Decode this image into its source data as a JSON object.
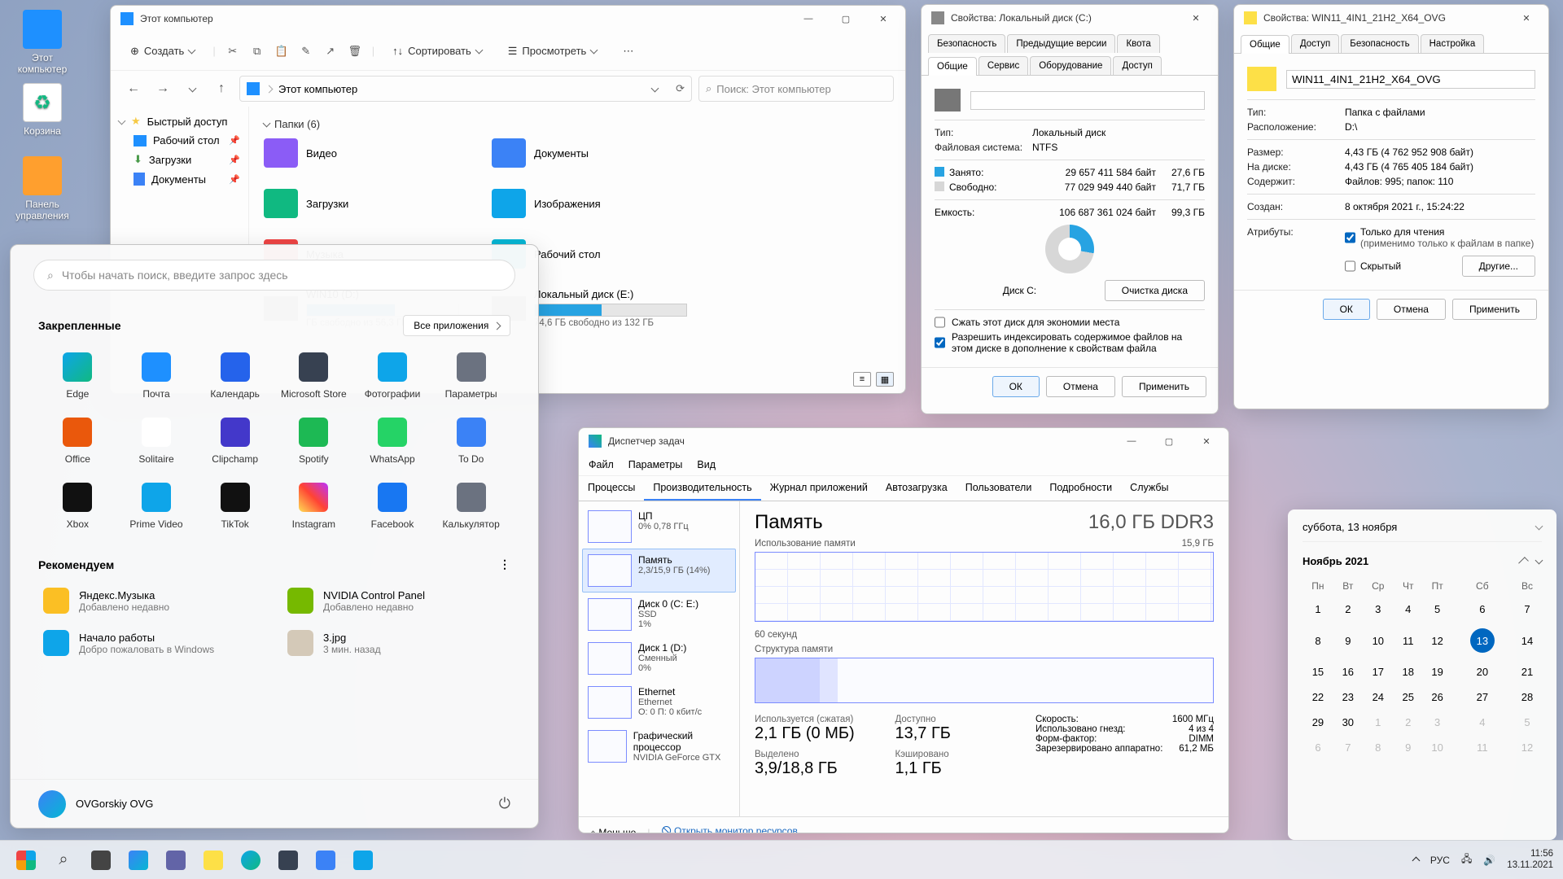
{
  "desktop": {
    "icons": [
      {
        "label": "Этот компьютер",
        "color": "#1e90ff"
      },
      {
        "label": "Корзина",
        "color": "#3bc4d6"
      },
      {
        "label": "Панель управления",
        "color": "#ff9f2e"
      }
    ]
  },
  "explorer": {
    "title": "Этот компьютер",
    "toolbar": {
      "create": "Создать",
      "sort": "Сортировать",
      "view": "Просмотреть"
    },
    "address": "Этот компьютер",
    "search_placeholder": "Поиск: Этот компьютер",
    "sidebar": [
      {
        "label": "Быстрый доступ",
        "icon": "#f6c945",
        "exp": true
      },
      {
        "label": "Рабочий стол",
        "icon": "#1e90ff",
        "pin": true,
        "sub": true
      },
      {
        "label": "Загрузки",
        "icon": "#4b9b4b",
        "pin": true,
        "sub": true
      },
      {
        "label": "Документы",
        "icon": "#3b82f6",
        "pin": true,
        "sub": true
      }
    ],
    "folders_header": "Папки (6)",
    "folders": [
      {
        "label": "Видео",
        "bg": "#8b5cf6"
      },
      {
        "label": "Документы",
        "bg": "#3b82f6"
      },
      {
        "label": "Загрузки",
        "bg": "#10b981"
      },
      {
        "label": "Изображения",
        "bg": "#0ea5e9"
      },
      {
        "label": "Музыка",
        "bg": "#ef4444"
      },
      {
        "label": "Рабочий стол",
        "bg": "#06b6d4"
      }
    ],
    "drives": [
      {
        "label": "WIN10 (D:)",
        "sub": "ГБ свободно из 56,3 ГБ",
        "fill": 58
      },
      {
        "label": "Локальный диск (E:)",
        "sub": "74,6 ГБ свободно из 132 ГБ",
        "fill": 44
      }
    ]
  },
  "start": {
    "search_placeholder": "Чтобы начать поиск, введите запрос здесь",
    "pinned_label": "Закрепленные",
    "all_apps": "Все приложения",
    "tiles": [
      {
        "label": "Edge",
        "bg": "linear-gradient(135deg,#0ea5e9,#10b981)"
      },
      {
        "label": "Почта",
        "bg": "#1e90ff"
      },
      {
        "label": "Календарь",
        "bg": "#2563eb"
      },
      {
        "label": "Microsoft Store",
        "bg": "#374151"
      },
      {
        "label": "Фотографии",
        "bg": "#0ea5e9"
      },
      {
        "label": "Параметры",
        "bg": "#6b7280"
      },
      {
        "label": "Office",
        "bg": "#ea580c"
      },
      {
        "label": "Solitaire",
        "bg": "#fff"
      },
      {
        "label": "Clipchamp",
        "bg": "#4338ca"
      },
      {
        "label": "Spotify",
        "bg": "#1db954"
      },
      {
        "label": "WhatsApp",
        "bg": "#25d366"
      },
      {
        "label": "To Do",
        "bg": "#3b82f6"
      },
      {
        "label": "Xbox",
        "bg": "#111"
      },
      {
        "label": "Prime Video",
        "bg": "#0ea5e9"
      },
      {
        "label": "TikTok",
        "bg": "#111"
      },
      {
        "label": "Instagram",
        "bg": "linear-gradient(45deg,#fd5,#f43,#b3f)"
      },
      {
        "label": "Facebook",
        "bg": "#1877f2"
      },
      {
        "label": "Калькулятор",
        "bg": "#6b7280"
      }
    ],
    "rec_label": "Рекомендуем",
    "recs": [
      {
        "title": "Яндекс.Музыка",
        "sub": "Добавлено недавно",
        "bg": "#fbbf24"
      },
      {
        "title": "NVIDIA Control Panel",
        "sub": "Добавлено недавно",
        "bg": "#76b900"
      },
      {
        "title": "Начало работы",
        "sub": "Добро пожаловать в Windows",
        "bg": "#0ea5e9"
      },
      {
        "title": "3.jpg",
        "sub": "3 мин. назад",
        "bg": "#d4c9b8"
      }
    ],
    "user": "OVGorskiy OVG"
  },
  "props_c": {
    "title": "Свойства: Локальный диск (C:)",
    "tabs_top": [
      "Безопасность",
      "Предыдущие версии",
      "Квота"
    ],
    "tabs_bot": [
      "Общие",
      "Сервис",
      "Оборудование",
      "Доступ"
    ],
    "type_lbl": "Тип:",
    "type": "Локальный диск",
    "fs_lbl": "Файловая система:",
    "fs": "NTFS",
    "used_lbl": "Занято:",
    "used_b": "29 657 411 584 байт",
    "used_g": "27,6 ГБ",
    "free_lbl": "Свободно:",
    "free_b": "77 029 949 440 байт",
    "free_g": "71,7 ГБ",
    "cap_lbl": "Емкость:",
    "cap_b": "106 687 361 024 байт",
    "cap_g": "99,3 ГБ",
    "disk_lbl": "Диск C:",
    "clean": "Очистка диска",
    "chk1": "Сжать этот диск для экономии места",
    "chk2": "Разрешить индексировать содержимое файлов на этом диске в дополнение к свойствам файла",
    "ok": "ОК",
    "cancel": "Отмена",
    "apply": "Применить"
  },
  "props_f": {
    "title": "Свойства: WIN11_4IN1_21H2_X64_OVG",
    "tabs": [
      "Общие",
      "Доступ",
      "Безопасность",
      "Настройка"
    ],
    "name": "WIN11_4IN1_21H2_X64_OVG",
    "type_lbl": "Тип:",
    "type": "Папка с файлами",
    "loc_lbl": "Расположение:",
    "loc": "D:\\",
    "size_lbl": "Размер:",
    "size": "4,43 ГБ (4 762 952 908 байт)",
    "ondisk_lbl": "На диске:",
    "ondisk": "4,43 ГБ (4 765 405 184 байт)",
    "contains_lbl": "Содержит:",
    "contains": "Файлов: 995; папок: 110",
    "created_lbl": "Создан:",
    "created": "8 октября 2021 г., 15:24:22",
    "attr_lbl": "Атрибуты:",
    "ro": "Только для чтения",
    "ro_sub": "(применимо только к файлам в папке)",
    "hidden": "Скрытый",
    "other": "Другие...",
    "ok": "ОК",
    "cancel": "Отмена",
    "apply": "Применить"
  },
  "tm": {
    "title": "Диспетчер задач",
    "menu": [
      "Файл",
      "Параметры",
      "Вид"
    ],
    "tabs": [
      "Процессы",
      "Производительность",
      "Журнал приложений",
      "Автозагрузка",
      "Пользователи",
      "Подробности",
      "Службы"
    ],
    "list": [
      {
        "name": "ЦП",
        "sub": "0% 0,78 ГГц"
      },
      {
        "name": "Память",
        "sub": "2,3/15,9 ГБ (14%)"
      },
      {
        "name": "Диск 0 (C: E:)",
        "sub": "SSD",
        "sub2": "1%"
      },
      {
        "name": "Диск 1 (D:)",
        "sub": "Сменный",
        "sub2": "0%"
      },
      {
        "name": "Ethernet",
        "sub": "Ethernet",
        "sub2": "О: 0 П: 0 кбит/с"
      },
      {
        "name": "Графический процессор",
        "sub": "NVIDIA GeForce GTX"
      }
    ],
    "h": "Память",
    "hr": "16,0 ГБ DDR3",
    "g1_lbl": "Использование памяти",
    "g1_r": "15,9 ГБ",
    "g1_b": "60 секунд",
    "g2_lbl": "Структура памяти",
    "stats": {
      "used_l": "Используется (сжатая)",
      "used_v": "2,1 ГБ (0 МБ)",
      "avail_l": "Доступно",
      "avail_v": "13,7 ГБ",
      "commit_l": "Выделено",
      "commit_v": "3,9/18,8 ГБ",
      "cache_l": "Кэшировано",
      "cache_v": "1,1 ГБ",
      "speed_l": "Скорость:",
      "speed_v": "1600 МГц",
      "slots_l": "Использовано гнезд:",
      "slots_v": "4 из 4",
      "ff_l": "Форм-фактор:",
      "ff_v": "DIMM",
      "res_l": "Зарезервировано аппаратно:",
      "res_v": "61,2 МБ"
    },
    "less": "Меньше",
    "rmon": "Открыть монитор ресурсов"
  },
  "cal": {
    "today": "суббота, 13 ноября",
    "month": "Ноябрь 2021",
    "dow": [
      "Пн",
      "Вт",
      "Ср",
      "Чт",
      "Пт",
      "Сб",
      "Вс"
    ],
    "weeks": [
      [
        1,
        2,
        3,
        4,
        5,
        6,
        7
      ],
      [
        8,
        9,
        10,
        11,
        12,
        13,
        14
      ],
      [
        15,
        16,
        17,
        18,
        19,
        20,
        21
      ],
      [
        22,
        23,
        24,
        25,
        26,
        27,
        28
      ],
      [
        29,
        30,
        1,
        2,
        3,
        4,
        5
      ],
      [
        6,
        7,
        8,
        9,
        10,
        11,
        12
      ]
    ],
    "today_day": 13
  },
  "taskbar": {
    "lang": "РУС",
    "time": "11:56",
    "date": "13.11.2021"
  }
}
